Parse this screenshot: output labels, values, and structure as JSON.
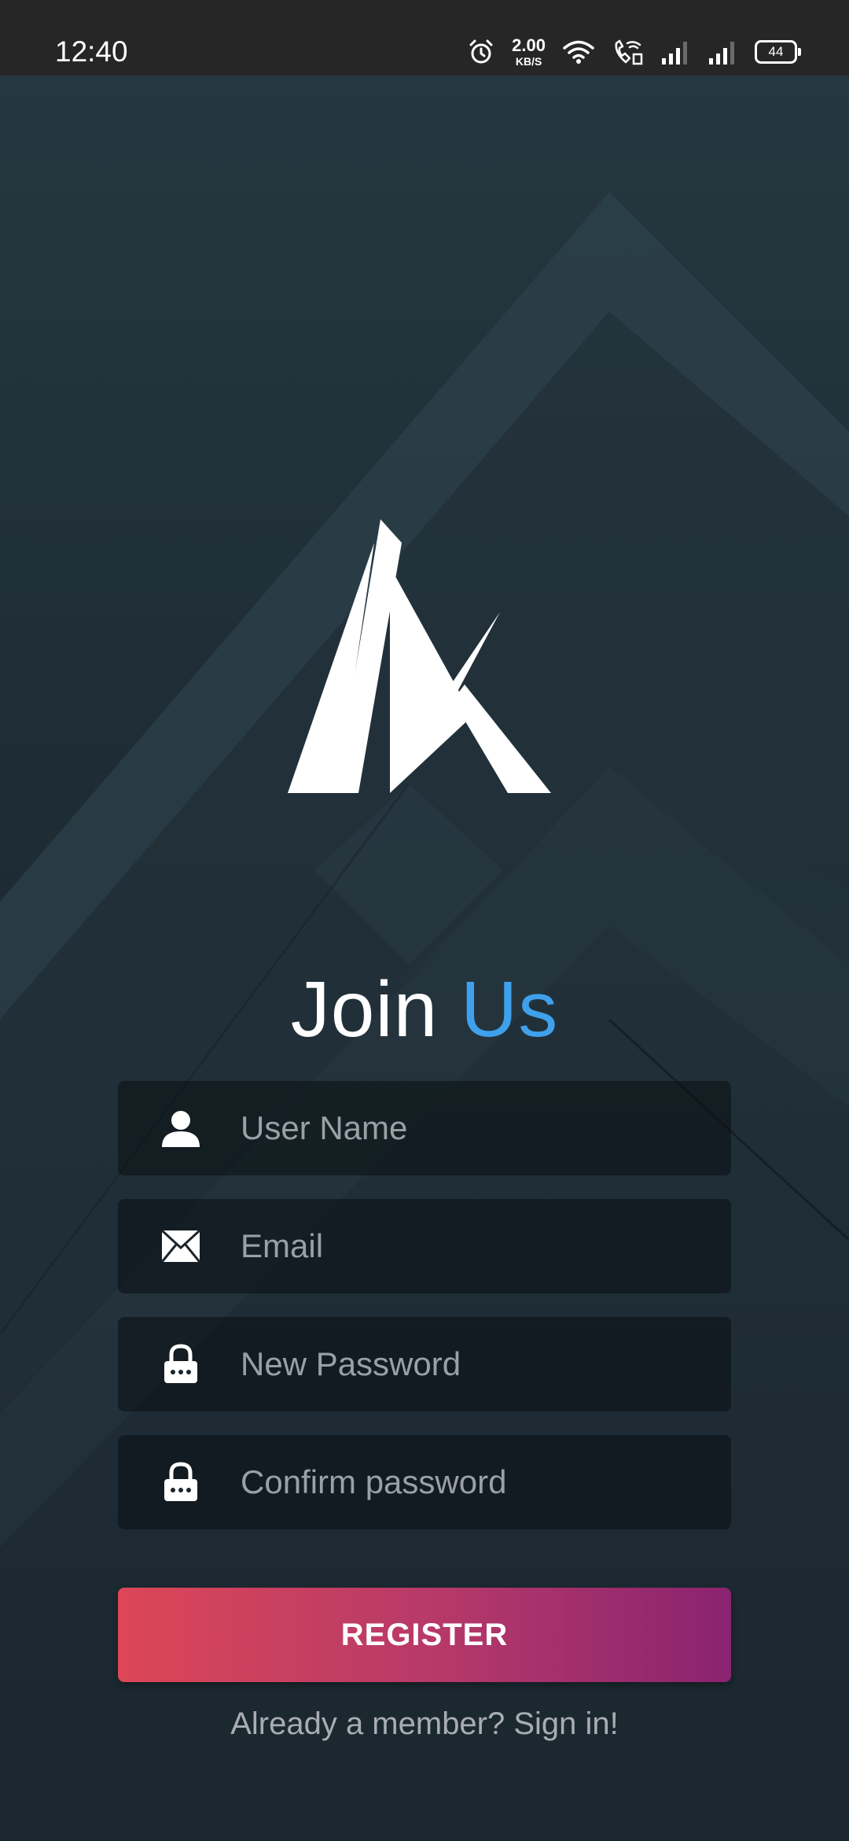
{
  "status_bar": {
    "time": "12:40",
    "net_speed_value": "2.00",
    "net_speed_unit": "KB/S",
    "battery": "44",
    "icons": [
      "alarm-icon",
      "wifi-icon",
      "wifi-calling-icon",
      "signal-icon",
      "signal-icon"
    ]
  },
  "logo": {
    "icon": "logo-icon"
  },
  "title": {
    "part1": "Join",
    "part2": "Us",
    "accent_color": "#3fa0ec"
  },
  "form": {
    "username": {
      "placeholder": "User Name",
      "value": "",
      "icon": "user-icon"
    },
    "email": {
      "placeholder": "Email",
      "value": "",
      "icon": "envelope-icon"
    },
    "new_password": {
      "placeholder": "New Password",
      "value": "",
      "icon": "lock-icon"
    },
    "confirm_password": {
      "placeholder": "Confirm password",
      "value": "",
      "icon": "lock-icon"
    }
  },
  "register_button": {
    "label": "REGISTER",
    "gradient_start": "#dc4657",
    "gradient_end": "#8a2370"
  },
  "signin_link": {
    "label": "Already a member? Sign in!"
  }
}
